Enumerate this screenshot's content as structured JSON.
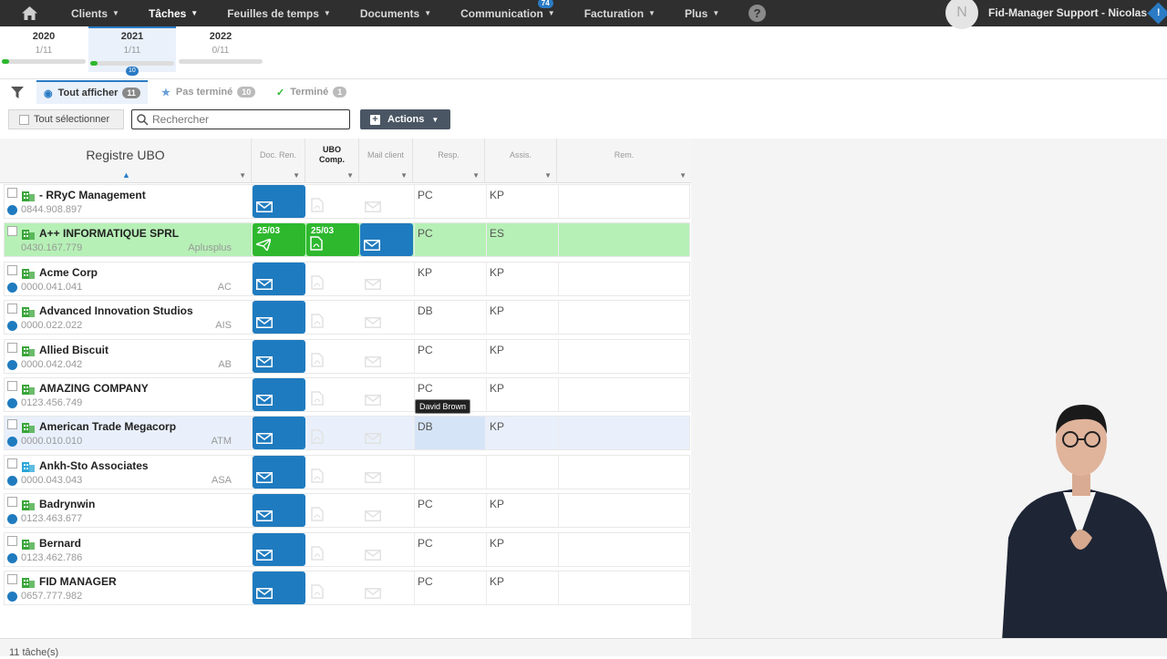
{
  "nav": {
    "items": [
      {
        "label": "Clients"
      },
      {
        "label": "Tâches"
      },
      {
        "label": "Feuilles de temps"
      },
      {
        "label": "Documents"
      },
      {
        "label": "Communication",
        "badge": "74"
      },
      {
        "label": "Facturation"
      },
      {
        "label": "Plus"
      }
    ],
    "help": "?",
    "avatar_initial": "N",
    "user": "Fid-Manager Support - Nicolas",
    "alert": "!"
  },
  "years": [
    {
      "label": "2020",
      "count": "1/11",
      "progress": 0.09
    },
    {
      "label": "2021",
      "count": "1/11",
      "progress": 0.09,
      "badge": "10"
    },
    {
      "label": "2022",
      "count": "0/11",
      "progress": 0
    }
  ],
  "filters": [
    {
      "label": "Tout afficher",
      "count": "11"
    },
    {
      "label": "Pas terminé",
      "count": "10"
    },
    {
      "label": "Terminé",
      "count": "1"
    }
  ],
  "toolbar": {
    "select_all": "Tout sélectionner",
    "search_placeholder": "Rechercher",
    "actions": "Actions"
  },
  "grid": {
    "title": "Registre UBO",
    "columns": {
      "doc": "Doc. Ren.",
      "ubo_1": "UBO",
      "ubo_2": "Comp.",
      "mail": "Mail client",
      "resp": "Resp.",
      "assis": "Assis.",
      "rem": "Rem."
    },
    "rows": [
      {
        "name": "- RRyC Management",
        "vat": "0844.908.897",
        "abbr": "",
        "resp": "PC",
        "assis": "KP"
      },
      {
        "name": "A++ INFORMATIQUE SPRL",
        "vat": "0430.167.779",
        "abbr": "Aplusplus",
        "resp": "PC",
        "assis": "ES",
        "doc_date": "25/03",
        "ubo_date": "25/03"
      },
      {
        "name": "Acme Corp",
        "vat": "0000.041.041",
        "abbr": "AC",
        "resp": "KP",
        "assis": "KP"
      },
      {
        "name": "Advanced Innovation Studios",
        "vat": "0000.022.022",
        "abbr": "AIS",
        "resp": "DB",
        "assis": "KP"
      },
      {
        "name": "Allied Biscuit",
        "vat": "0000.042.042",
        "abbr": "AB",
        "resp": "PC",
        "assis": "KP"
      },
      {
        "name": "AMAZING COMPANY",
        "vat": "0123.456.749",
        "abbr": "",
        "resp": "PC",
        "assis": "KP"
      },
      {
        "name": "American Trade Megacorp",
        "vat": "0000.010.010",
        "abbr": "ATM",
        "resp": "DB",
        "assis": "KP"
      },
      {
        "name": "Ankh-Sto Associates",
        "vat": "0000.043.043",
        "abbr": "ASA",
        "resp": "",
        "assis": ""
      },
      {
        "name": "Badrynwin",
        "vat": "0123.463.677",
        "abbr": "",
        "resp": "PC",
        "assis": "KP"
      },
      {
        "name": "Bernard",
        "vat": "0123.462.786",
        "abbr": "",
        "resp": "PC",
        "assis": "KP"
      },
      {
        "name": "FID MANAGER",
        "vat": "0657.777.982",
        "abbr": "",
        "resp": "PC",
        "assis": "KP"
      }
    ],
    "tooltip": "David Brown"
  },
  "footer": {
    "count": "11 tâche(s)"
  },
  "colors": {
    "nav_bg": "#2f2f2f",
    "accent": "#2a7bc4",
    "done_green": "#2eb82e",
    "doc_blue": "#1f7bbf",
    "row_done": "#b6f0b6"
  }
}
